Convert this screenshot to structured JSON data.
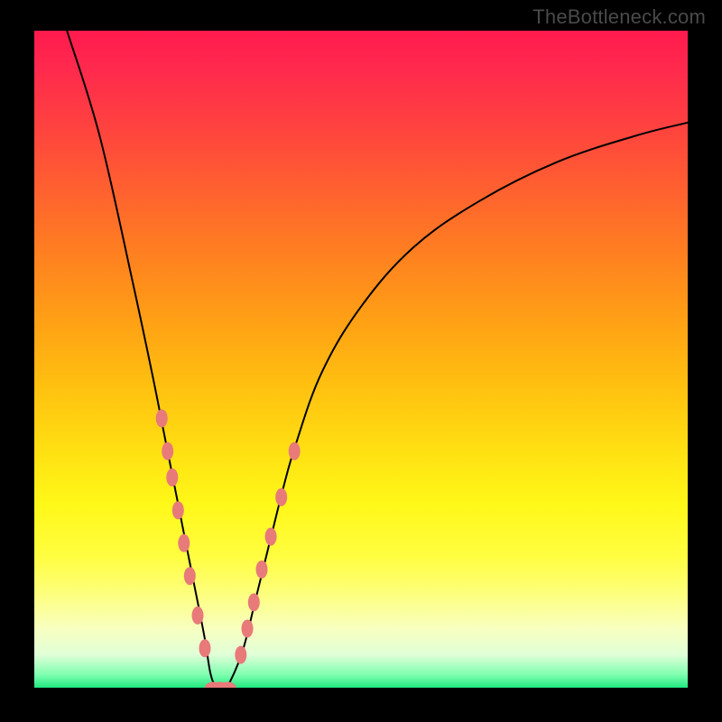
{
  "watermark": "TheBottleneck.com",
  "chart_data": {
    "type": "line",
    "title": "",
    "xlabel": "",
    "ylabel": "",
    "xlim": [
      0,
      100
    ],
    "ylim": [
      0,
      100
    ],
    "series": [
      {
        "name": "bottleneck-curve",
        "x": [
          5,
          10,
          15,
          18,
          20,
          22,
          24,
          26,
          27,
          28,
          29,
          30,
          32,
          34,
          36,
          38,
          40,
          44,
          50,
          58,
          68,
          80,
          92,
          100
        ],
        "y": [
          100,
          84,
          62,
          48,
          38,
          28,
          18,
          8,
          2,
          0,
          0,
          1,
          6,
          14,
          22,
          30,
          37,
          48,
          58,
          67,
          74,
          80,
          84,
          86
        ]
      }
    ],
    "markers_left": {
      "name": "left-spread-markers",
      "x": [
        19.5,
        20.4,
        21.1,
        22.0,
        22.9,
        23.8,
        25.0,
        26.1
      ],
      "y": [
        41,
        36,
        32,
        27,
        22,
        17,
        11,
        6
      ]
    },
    "markers_right": {
      "name": "right-spread-markers",
      "x": [
        31.6,
        32.6,
        33.6,
        34.8,
        36.2,
        37.8,
        39.8
      ],
      "y": [
        5,
        9,
        13,
        18,
        23,
        29,
        36
      ]
    },
    "markers_valley": {
      "name": "valley-markers",
      "x": [
        27.4,
        28.5,
        29.6
      ],
      "y": [
        0,
        0,
        0
      ]
    },
    "gradient_stops": [
      {
        "pct": 0,
        "color": "#ff1a4d"
      },
      {
        "pct": 50,
        "color": "#ffd400"
      },
      {
        "pct": 90,
        "color": "#f8ffa0"
      },
      {
        "pct": 100,
        "color": "#20e880"
      }
    ],
    "marker_color": "#e87a7a",
    "curve_color": "#000000"
  }
}
